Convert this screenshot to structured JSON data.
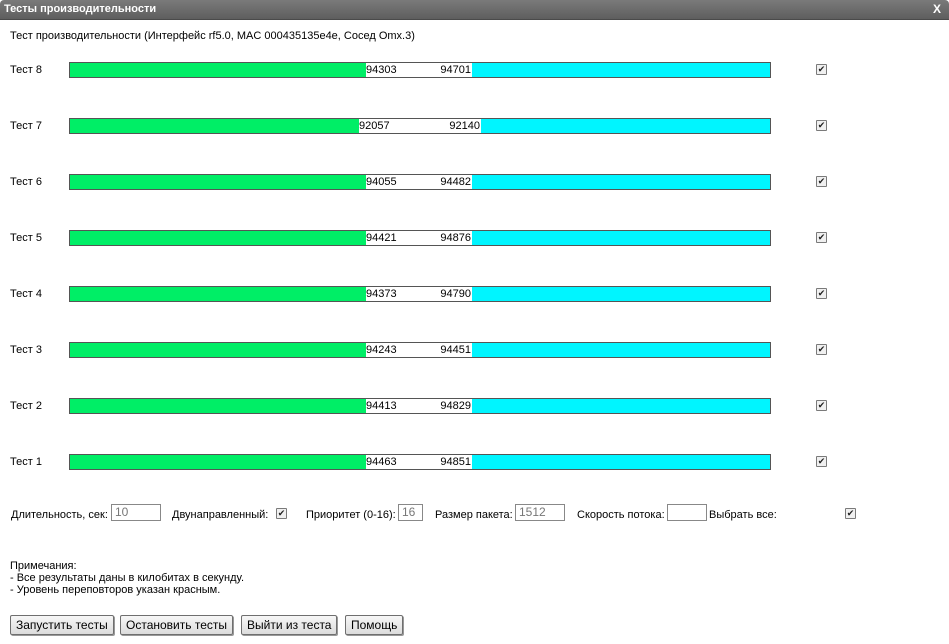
{
  "window": {
    "title": "Тесты производительности",
    "close_label": "X"
  },
  "heading": "Тест производительности (Интерфейс rf5.0, MAC 000435135e4e, Сосед Omx.3)",
  "tests": [
    {
      "label": "Тест 8",
      "left_value": "94303",
      "right_value": "94701",
      "green_fraction": 0.423,
      "cyan_fraction": 0.425,
      "checked": true
    },
    {
      "label": "Тест 7",
      "left_value": "92057",
      "right_value": "92140",
      "green_fraction": 0.413,
      "cyan_fraction": 0.413,
      "checked": true
    },
    {
      "label": "Тест 6",
      "left_value": "94055",
      "right_value": "94482",
      "green_fraction": 0.423,
      "cyan_fraction": 0.425,
      "checked": true
    },
    {
      "label": "Тест 5",
      "left_value": "94421",
      "right_value": "94876",
      "green_fraction": 0.423,
      "cyan_fraction": 0.425,
      "checked": true
    },
    {
      "label": "Тест 4",
      "left_value": "94373",
      "right_value": "94790",
      "green_fraction": 0.423,
      "cyan_fraction": 0.425,
      "checked": true
    },
    {
      "label": "Тест 3",
      "left_value": "94243",
      "right_value": "94451",
      "green_fraction": 0.423,
      "cyan_fraction": 0.425,
      "checked": true
    },
    {
      "label": "Тест 2",
      "left_value": "94413",
      "right_value": "94829",
      "green_fraction": 0.423,
      "cyan_fraction": 0.425,
      "checked": true
    },
    {
      "label": "Тест 1",
      "left_value": "94463",
      "right_value": "94851",
      "green_fraction": 0.423,
      "cyan_fraction": 0.425,
      "checked": true
    }
  ],
  "colors": {
    "green": "#00ee66",
    "cyan": "#00f5ff",
    "titlebar": "#6b6b6b"
  },
  "controls": {
    "duration_label": "Длительность, сек:",
    "duration_value": "10",
    "bidirectional_label": "Двунаправленный:",
    "bidirectional_checked": true,
    "priority_label": "Приоритет (0-16):",
    "priority_value": "16",
    "packet_size_label": "Размер пакета:",
    "packet_size_value": "1512",
    "stream_speed_label": "Скорость потока:",
    "stream_speed_value": "",
    "select_all_label": "Выбрать все:",
    "select_all_checked": true
  },
  "notes": {
    "title": "Примечания:",
    "line1": "- Все результаты даны в килобитах в секунду.",
    "line2": "- Уровень переповторов указан красным."
  },
  "buttons": {
    "start": "Запустить тесты",
    "stop": "Остановить тесты",
    "exit": "Выйти из теста",
    "help": "Помощь"
  },
  "check_glyph": "✔"
}
